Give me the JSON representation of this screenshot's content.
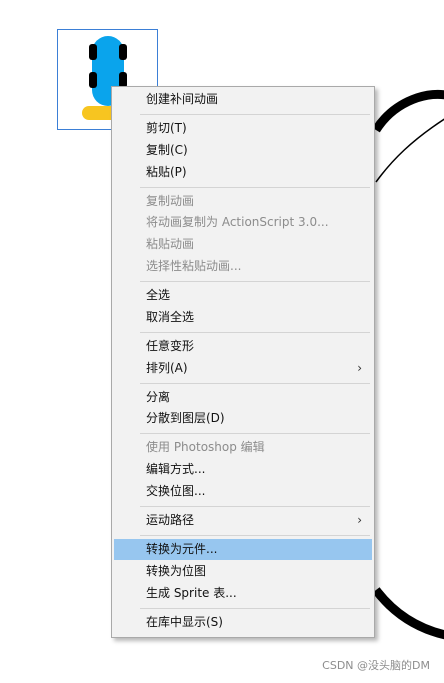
{
  "stage": {
    "object_colors": {
      "body": "#0aa4ec",
      "wheels": "#000000",
      "base": "#f7c520"
    }
  },
  "context_menu": {
    "groups": [
      [
        {
          "label": "创建补间动画",
          "enabled": true
        }
      ],
      [
        {
          "label": "剪切(T)",
          "enabled": true
        },
        {
          "label": "复制(C)",
          "enabled": true
        },
        {
          "label": "粘贴(P)",
          "enabled": true
        }
      ],
      [
        {
          "label": "复制动画",
          "enabled": false
        },
        {
          "label": "将动画复制为 ActionScript 3.0...",
          "enabled": false
        },
        {
          "label": "粘贴动画",
          "enabled": false
        },
        {
          "label": "选择性粘贴动画...",
          "enabled": false
        }
      ],
      [
        {
          "label": "全选",
          "enabled": true
        },
        {
          "label": "取消全选",
          "enabled": true
        }
      ],
      [
        {
          "label": "任意变形",
          "enabled": true
        },
        {
          "label": "排列(A)",
          "enabled": true,
          "submenu": true
        }
      ],
      [
        {
          "label": "分离",
          "enabled": true
        },
        {
          "label": "分散到图层(D)",
          "enabled": true
        }
      ],
      [
        {
          "label": "使用 Photoshop 编辑",
          "enabled": false
        },
        {
          "label": "编辑方式...",
          "enabled": true
        },
        {
          "label": "交换位图...",
          "enabled": true
        }
      ],
      [
        {
          "label": "运动路径",
          "enabled": true,
          "submenu": true
        }
      ],
      [
        {
          "label": "转换为元件...",
          "enabled": true,
          "highlighted": true
        },
        {
          "label": "转换为位图",
          "enabled": true
        },
        {
          "label": "生成 Sprite 表...",
          "enabled": true
        }
      ],
      [
        {
          "label": "在库中显示(S)",
          "enabled": true
        }
      ]
    ],
    "submenu_glyph": "›",
    "highlight_color": "#97c6ef"
  },
  "watermark": "CSDN @没头脑的DM"
}
